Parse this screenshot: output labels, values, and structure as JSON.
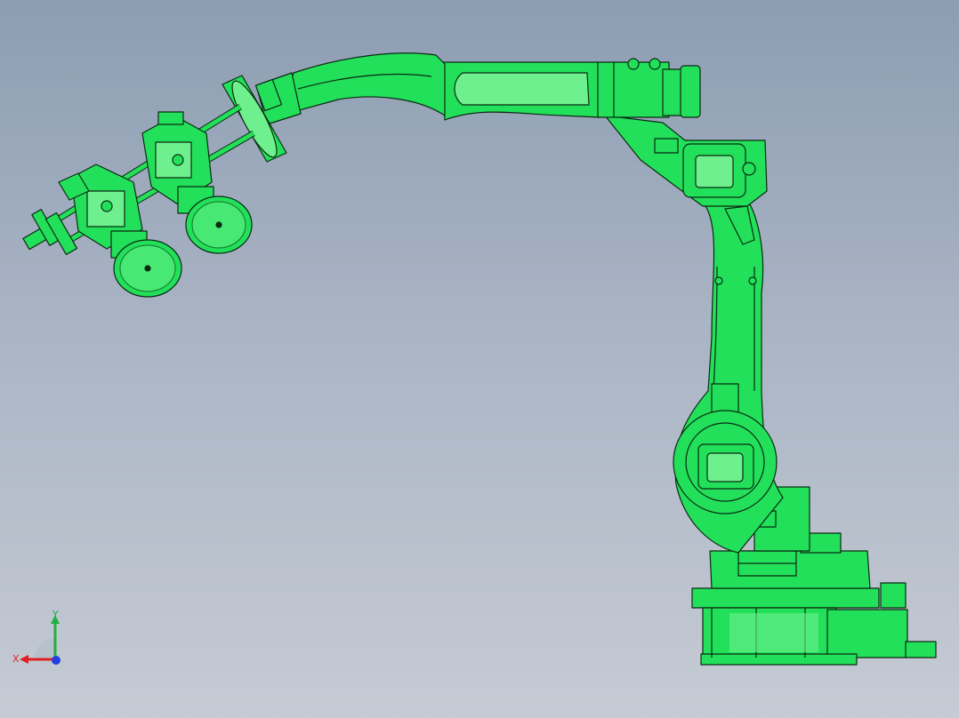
{
  "viewport": {
    "model_color": "#22e05a",
    "model_edge_color": "#0b2a12",
    "model_highlight": "#6ff08f",
    "background_top": "#8d9db2",
    "background_bottom": "#c6cbd4"
  },
  "model": {
    "parts": [
      "base",
      "turret",
      "lower-arm",
      "elbow",
      "upper-arm",
      "wrist",
      "flange",
      "gripper-frame",
      "suction-cup-1",
      "suction-cup-2",
      "suction-cup-3"
    ]
  },
  "triad": {
    "x_label": "X",
    "y_label": "Y",
    "x_color": "#e02020",
    "y_color": "#20b040",
    "z_color": "#2040e0"
  }
}
